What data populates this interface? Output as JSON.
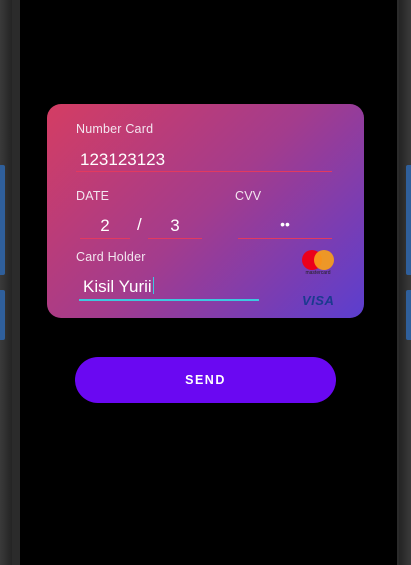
{
  "card": {
    "number_label": "Number Card",
    "number_value": "123123123",
    "date_label": "DATE",
    "month_value": "2",
    "date_separator": "/",
    "year_value": "3",
    "cvv_label": "CVV",
    "cvv_value": "••",
    "holder_label": "Card Holder",
    "holder_value": "Kisil Yurii",
    "mastercard_text": "mastercard",
    "visa_text": "VISA"
  },
  "send_button": {
    "label": "SEND"
  },
  "colors": {
    "card_gradient_start": "#d43d63",
    "card_gradient_end": "#5b3ecf",
    "field_underline": "#e33a5f",
    "focused_underline": "#3ec8e0",
    "send_button": "#6a08f2"
  },
  "icons": [
    "mastercard-logo-icon",
    "visa-logo-icon"
  ]
}
